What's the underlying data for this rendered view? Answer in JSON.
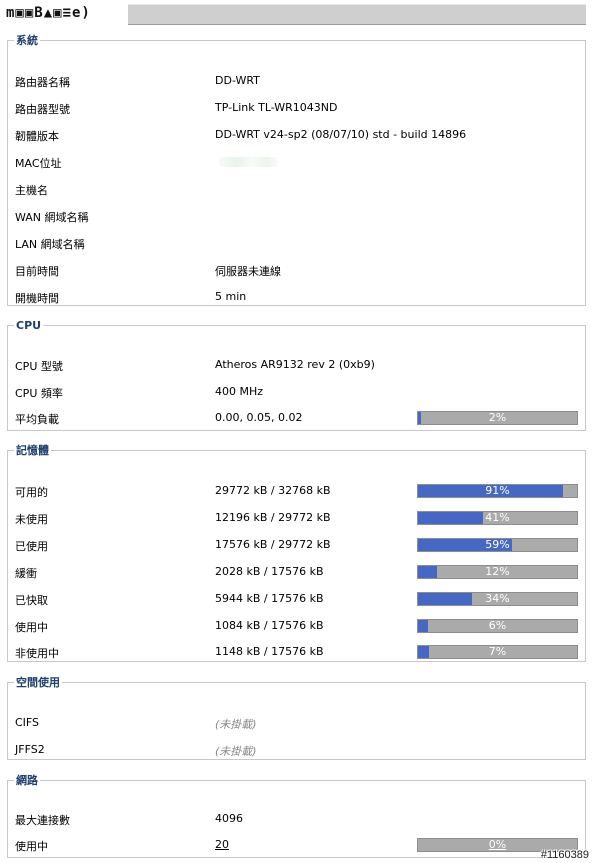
{
  "header": {
    "logo_text": "m▣▣B▲▣≡e)"
  },
  "system": {
    "title": "系統",
    "rows": [
      {
        "label": "路由器名稱",
        "value": "DD-WRT"
      },
      {
        "label": "路由器型號",
        "value": "TP-Link TL-WR1043ND"
      },
      {
        "label": "韌體版本",
        "value": "DD-WRT v24-sp2 (08/07/10) std - build 14896"
      },
      {
        "label": "MAC位址",
        "value": ""
      },
      {
        "label": "主機名",
        "value": ""
      },
      {
        "label": "WAN 網域名稱",
        "value": ""
      },
      {
        "label": "LAN 網域名稱",
        "value": ""
      },
      {
        "label": "目前時間",
        "value": "伺服器未連線"
      },
      {
        "label": "開機時間",
        "value": "5 min"
      }
    ]
  },
  "cpu": {
    "title": "CPU",
    "rows": [
      {
        "label": "CPU 型號",
        "value": "Atheros AR9132 rev 2 (0xb9)"
      },
      {
        "label": "CPU 頻率",
        "value": "400 MHz"
      },
      {
        "label": "平均負載",
        "value": "0.00, 0.05, 0.02",
        "bar": {
          "percent": 2,
          "text": "2%"
        }
      }
    ]
  },
  "memory": {
    "title": "記憶體",
    "rows": [
      {
        "label": "可用的",
        "value": "29772 kB / 32768 kB",
        "bar": {
          "percent": 91,
          "text": "91%"
        }
      },
      {
        "label": "未使用",
        "value": "12196 kB / 29772 kB",
        "bar": {
          "percent": 41,
          "text": "41%"
        }
      },
      {
        "label": "已使用",
        "value": "17576 kB / 29772 kB",
        "bar": {
          "percent": 59,
          "text": "59%"
        }
      },
      {
        "label": "緩衝",
        "value": "2028 kB / 17576 kB",
        "bar": {
          "percent": 12,
          "text": "12%"
        }
      },
      {
        "label": "已快取",
        "value": "5944 kB / 17576 kB",
        "bar": {
          "percent": 34,
          "text": "34%"
        }
      },
      {
        "label": "使用中",
        "value": "1084 kB / 17576 kB",
        "bar": {
          "percent": 6,
          "text": "6%"
        }
      },
      {
        "label": "非使用中",
        "value": "1148 kB / 17576 kB",
        "bar": {
          "percent": 7,
          "text": "7%"
        }
      }
    ]
  },
  "space": {
    "title": "空間使用",
    "rows": [
      {
        "label": "CIFS",
        "value": "(未掛載)"
      },
      {
        "label": "JFFS2",
        "value": "(未掛載)"
      }
    ]
  },
  "network": {
    "title": "網路",
    "rows": [
      {
        "label": "最大連接數",
        "value": "4096"
      },
      {
        "label": "使用中",
        "value": "20",
        "bar": {
          "percent": 0,
          "text": "0%"
        }
      }
    ]
  },
  "watermark": "#1160389",
  "colors": {
    "bar_fill": "#4468c3",
    "bar_bg": "#aaaaaa",
    "legend": "#1f3f6e"
  }
}
